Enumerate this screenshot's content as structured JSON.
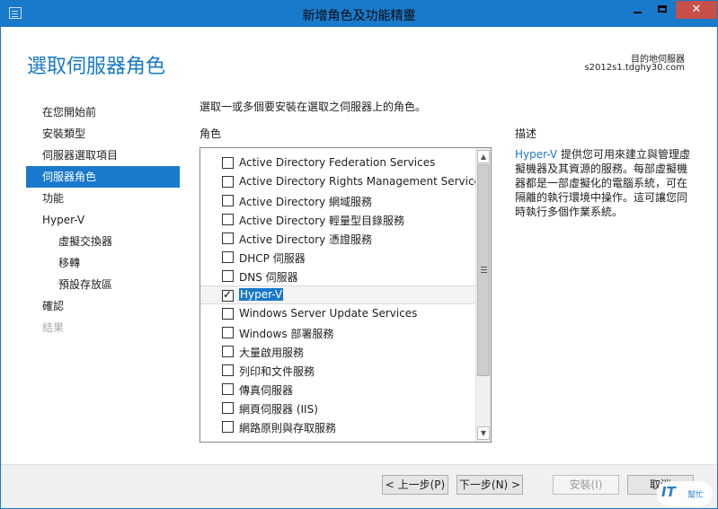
{
  "window": {
    "title": "新增角色及功能精靈"
  },
  "header": {
    "page_title": "選取伺服器角色",
    "dest_label": "目的地伺服器",
    "dest_server": "s2012s1.tdghy30.com"
  },
  "nav": {
    "items": [
      {
        "label": "在您開始前",
        "state": "normal",
        "level": 0
      },
      {
        "label": "安裝類型",
        "state": "normal",
        "level": 0
      },
      {
        "label": "伺服器選取項目",
        "state": "normal",
        "level": 0
      },
      {
        "label": "伺服器角色",
        "state": "active",
        "level": 0
      },
      {
        "label": "功能",
        "state": "normal",
        "level": 0
      },
      {
        "label": "Hyper-V",
        "state": "normal",
        "level": 0
      },
      {
        "label": "虛擬交換器",
        "state": "normal",
        "level": 1
      },
      {
        "label": "移轉",
        "state": "normal",
        "level": 1
      },
      {
        "label": "預設存放區",
        "state": "normal",
        "level": 1
      },
      {
        "label": "確認",
        "state": "normal",
        "level": 0
      },
      {
        "label": "結果",
        "state": "disabled",
        "level": 0
      }
    ]
  },
  "main": {
    "instruction": "選取一或多個要安裝在選取之伺服器上的角色。",
    "roles_header": "角色",
    "description_header": "描述",
    "roles": [
      {
        "label": "Active Directory Federation Services",
        "checked": false,
        "selected": false
      },
      {
        "label": "Active Directory Rights Management Services",
        "checked": false,
        "selected": false
      },
      {
        "label": "Active Directory 網域服務",
        "checked": false,
        "selected": false
      },
      {
        "label": "Active Directory 輕量型目錄服務",
        "checked": false,
        "selected": false
      },
      {
        "label": "Active Directory 憑證服務",
        "checked": false,
        "selected": false
      },
      {
        "label": "DHCP 伺服器",
        "checked": false,
        "selected": false
      },
      {
        "label": "DNS 伺服器",
        "checked": false,
        "selected": false
      },
      {
        "label": "Hyper-V",
        "checked": true,
        "selected": true
      },
      {
        "label": "Windows Server Update Services",
        "checked": false,
        "selected": false
      },
      {
        "label": "Windows 部署服務",
        "checked": false,
        "selected": false
      },
      {
        "label": "大量啟用服務",
        "checked": false,
        "selected": false
      },
      {
        "label": "列印和文件服務",
        "checked": false,
        "selected": false
      },
      {
        "label": "傳真伺服器",
        "checked": false,
        "selected": false
      },
      {
        "label": "網頁伺服器 (IIS)",
        "checked": false,
        "selected": false
      },
      {
        "label": "網路原則與存取服務",
        "checked": false,
        "selected": false
      }
    ],
    "description": {
      "link": "Hyper-V",
      "text": " 提供您可用來建立與管理虛擬機器及其資源的服務。每部虛擬機器都是一部虛擬化的電腦系統，可在隔離的執行環境中操作。這可讓您同時執行多個作業系統。"
    }
  },
  "footer": {
    "prev_label": "< 上一步(P)",
    "next_label": "下一步(N) >",
    "install_label": "安裝(I)",
    "cancel_label": "取消"
  },
  "watermark": {
    "text": "IT",
    "sub": "幫忙"
  },
  "colors": {
    "accent": "#1979ca",
    "close": "#c7504b"
  }
}
